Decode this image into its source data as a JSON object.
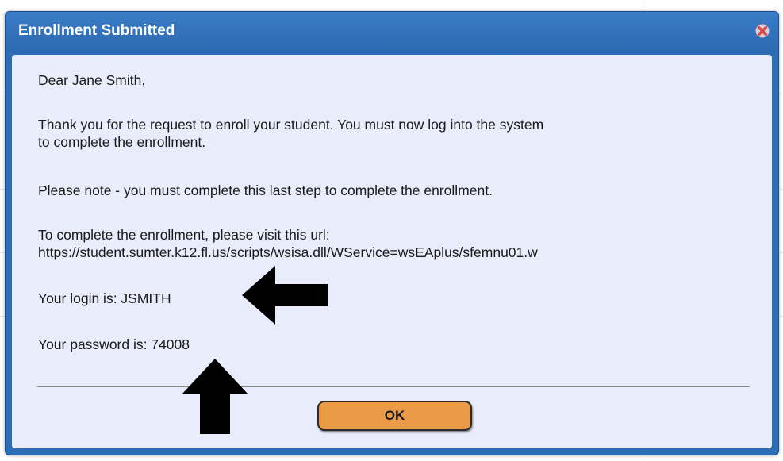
{
  "dialog": {
    "title": "Enrollment Submitted",
    "close_icon": "close-x-icon",
    "greeting": "Dear Jane Smith,",
    "paragraph1_line1": "Thank you for the request to enroll your student. You must now log into the system",
    "paragraph1_line2": "to complete the enrollment.",
    "note": "Please note - you must complete this last step to complete the enrollment.",
    "url_intro": "To complete the enrollment, please visit this url:",
    "url": "https://student.sumter.k12.fl.us/scripts/wsisa.dll/WService=wsEAplus/sfemnu01.w",
    "login_line": "Your login is: JSMITH",
    "password_line": "Your password is: 74008",
    "ok_label": "OK"
  },
  "colors": {
    "titlebar": "#2d6db5",
    "content_bg": "#e9ecfb",
    "ok_button": "#eb9a48",
    "close_icon": "#e05555",
    "arrows": "#000000"
  },
  "annotations": {
    "arrow_left_icon": "arrow-left-icon",
    "arrow_up_icon": "arrow-up-icon"
  }
}
